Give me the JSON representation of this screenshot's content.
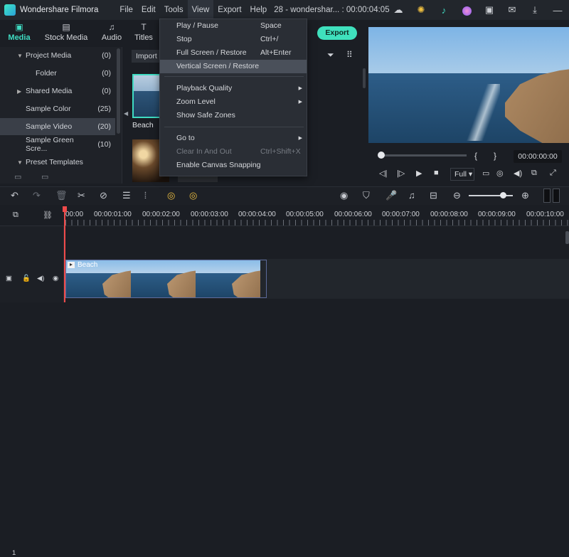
{
  "titlebar": {
    "app_name": "Wondershare Filmora",
    "menu": [
      "File",
      "Edit",
      "Tools",
      "View",
      "Export",
      "Help"
    ],
    "project": "28 - wondershar... : 00:00:04:05"
  },
  "tabs": [
    {
      "label": "Media",
      "icon": "media-icon",
      "glyph": "▣"
    },
    {
      "label": "Stock Media",
      "icon": "stock-media-icon",
      "glyph": "▤"
    },
    {
      "label": "Audio",
      "icon": "audio-icon",
      "glyph": "♫"
    },
    {
      "label": "Titles",
      "icon": "titles-icon",
      "glyph": "T"
    }
  ],
  "left_panel": {
    "items": [
      {
        "label": "Project Media",
        "count": "(0)",
        "arrow": "▼"
      },
      {
        "label": "Folder",
        "count": "(0)",
        "arrow": ""
      },
      {
        "label": "Shared Media",
        "count": "(0)",
        "arrow": "▶"
      },
      {
        "label": "Sample Color",
        "count": "(25)",
        "arrow": ""
      },
      {
        "label": "Sample Video",
        "count": "(20)",
        "arrow": ""
      },
      {
        "label": "Sample Green Scre...",
        "count": "(10)",
        "arrow": ""
      },
      {
        "label": "Preset Templates",
        "count": "",
        "arrow": "▼"
      }
    ]
  },
  "media": {
    "import_label": "Import",
    "thumb_label": "Beach"
  },
  "view_menu": {
    "items": [
      {
        "label": "Play / Pause",
        "shortcut": "Space"
      },
      {
        "label": "Stop",
        "shortcut": "Ctrl+/"
      },
      {
        "label": "Full Screen / Restore",
        "shortcut": "Alt+Enter"
      },
      {
        "label": "Vertical Screen / Restore",
        "shortcut": ""
      },
      {
        "label": "Playback Quality",
        "shortcut": ""
      },
      {
        "label": "Zoom Level",
        "shortcut": ""
      },
      {
        "label": "Show Safe Zones",
        "shortcut": ""
      },
      {
        "label": "Go to",
        "shortcut": ""
      },
      {
        "label": "Clear In And Out",
        "shortcut": "Ctrl+Shift+X"
      },
      {
        "label": "Enable Canvas Snapping",
        "shortcut": ""
      }
    ]
  },
  "export_label": "Export",
  "player": {
    "timecode": "00:00:00:00",
    "quality": "Full",
    "progress": 0
  },
  "timeline": {
    "ruler": [
      "00:00",
      "00:00:01:00",
      "00:00:02:00",
      "00:00:03:00",
      "00:00:04:00",
      "00:00:05:00",
      "00:00:06:00",
      "00:00:07:00",
      "00:00:08:00",
      "00:00:09:00",
      "00:00:10:00"
    ],
    "clip_label": "Beach",
    "track_number": "1",
    "zoom_level": 0.7
  },
  "colors": {
    "accent": "#3fdcc2",
    "export_button": "#3fe0bd",
    "playhead": "#f04a4a"
  }
}
